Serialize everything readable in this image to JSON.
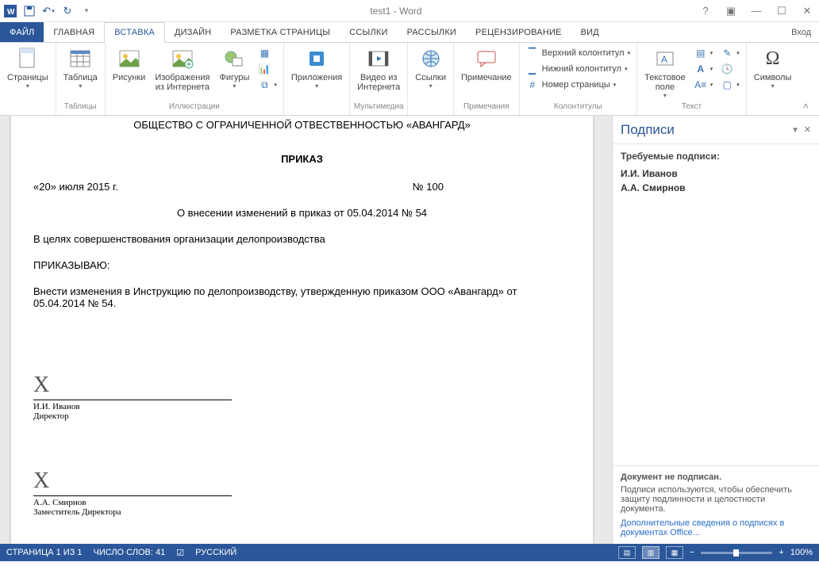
{
  "title": "test1 - Word",
  "signin": "Вход",
  "tabs": {
    "file": "ФАЙЛ",
    "home": "ГЛАВНАЯ",
    "insert": "ВСТАВКА",
    "design": "ДИЗАЙН",
    "layout": "РАЗМЕТКА СТРАНИЦЫ",
    "refs": "ССЫЛКИ",
    "mail": "РАССЫЛКИ",
    "review": "РЕЦЕНЗИРОВАНИЕ",
    "view": "ВИД"
  },
  "ribbon": {
    "pages": {
      "btn": "Страницы",
      "group": ""
    },
    "table": {
      "btn": "Таблица",
      "group": "Таблицы"
    },
    "illus": {
      "pics": "Рисунки",
      "online": "Изображения\nиз Интернета",
      "shapes": "Фигуры",
      "group": "Иллюстрации"
    },
    "apps": {
      "btn": "Приложения",
      "group": ""
    },
    "media": {
      "btn": "Видео из\nИнтернета",
      "group": "Мультимедиа"
    },
    "links": {
      "btn": "Ссылки",
      "group": ""
    },
    "comments": {
      "btn": "Примечание",
      "group": "Примечания"
    },
    "headerfooter": {
      "top": "Верхний колонтитул",
      "bottom": "Нижний колонтитул",
      "pagenum": "Номер страницы",
      "group": "Колонтитулы"
    },
    "text": {
      "btn": "Текстовое\nполе",
      "group": "Текст"
    },
    "symbols": {
      "btn": "Символы",
      "group": ""
    }
  },
  "doc": {
    "org": "ОБЩЕСТВО С ОГРАНИЧЕННОЙ ОТВЕСТВЕННОСТЬЮ «АВАНГАРД»",
    "title": "ПРИКАЗ",
    "date": "«20» июля 2015 г.",
    "num": "№ 100",
    "subj": "О внесении изменений в приказ от 05.04.2014 № 54",
    "intro": "В целях совершенствования организации делопроизводства",
    "order": "ПРИКАЗЫВАЮ:",
    "body": "Внести изменения в Инструкцию по делопроизводству, утвержденную приказом ООО «Авангард» от 05.04.2014 № 54.",
    "sig1": {
      "name": "И.И. Иванов",
      "role": "Директор"
    },
    "sig2": {
      "name": "А.А. Смирнов",
      "role": "Заместитель Директора"
    }
  },
  "panel": {
    "title": "Подписи",
    "required": "Требуемые подписи:",
    "signers": [
      "И.И. Иванов",
      "А.А. Смирнов"
    ],
    "unsigned": "Документ не подписан.",
    "desc": "Подписи используются, чтобы обеспечить защиту подлинности и целостности документа.",
    "link": "Дополнительные сведения о подписях в документах Office..."
  },
  "status": {
    "page": "СТРАНИЦА 1 ИЗ 1",
    "words": "ЧИСЛО СЛОВ: 41",
    "lang": "РУССКИЙ",
    "zoom": "100%"
  }
}
